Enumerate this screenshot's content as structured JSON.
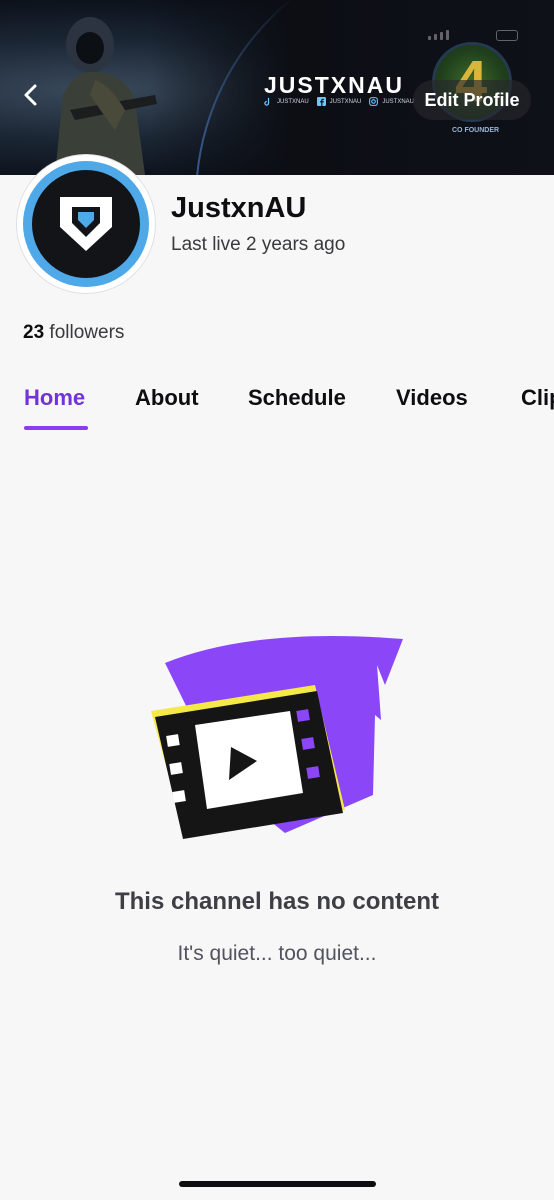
{
  "banner": {
    "brand": "JUSTXNAU",
    "socials": [
      {
        "icon": "tiktok-icon",
        "label": "JUSTXNAU"
      },
      {
        "icon": "facebook-icon",
        "label": "JUSTXNAU"
      },
      {
        "icon": "instagram-icon",
        "label": "JUSTXNAU"
      }
    ],
    "badge_text": "4",
    "badge_caption": "CO FOUNDER",
    "back_icon": "chevron-left-icon",
    "edit_profile_label": "Edit Profile"
  },
  "channel": {
    "name": "JustxnAU",
    "last_live": "Last live 2 years ago",
    "followers_count": "23",
    "followers_label": "followers"
  },
  "tabs": [
    {
      "label": "Home",
      "active": true
    },
    {
      "label": "About",
      "active": false
    },
    {
      "label": "Schedule",
      "active": false
    },
    {
      "label": "Videos",
      "active": false
    },
    {
      "label": "Clips",
      "active": false
    }
  ],
  "empty_state": {
    "icon": "film-play-icon",
    "title": "This channel has no content",
    "subtitle": "It's quiet... too quiet..."
  },
  "colors": {
    "accent": "#7233d9",
    "underline": "#8a3df5",
    "avatar_ring": "#4fa8e8",
    "illustration_purple": "#8b47f7",
    "illustration_yellow": "#f5e94a"
  }
}
